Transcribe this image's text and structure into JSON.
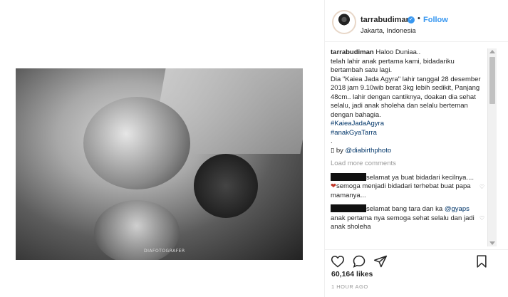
{
  "post": {
    "username": "tarrabudiman",
    "follow_label": "Follow",
    "dot": "•",
    "location": "Jakarta, Indonesia",
    "photo_watermark": "DIAFOTOGRAFER"
  },
  "caption": {
    "user": "tarrabudiman",
    "lines": [
      "Haloo Duniaa..",
      "telah lahir anak pertama kami, bidadariku bertambah satu lagi.",
      "Dia \"Kaiea Jada Agyra\" lahir tanggal 28 desember 2018 jam 9.10wib berat 3kg lebih sedikit, Panjang 48cm.. lahir dengan cantiknya, doakan dia sehat selalu, jadi anak sholeha dan selalu berteman dengan bahagia."
    ],
    "hashtag1": "#KaieaJadaAgyra",
    "hashtag2": "#anakGyaTarra",
    "dot_line": ".",
    "credit_prefix": "▯ by ",
    "credit_mention": "@diabirthphoto"
  },
  "comments": {
    "load_more": "Load more comments",
    "items": [
      {
        "text1": "selamat ya buat bidadari kecilnya....",
        "heart": "❤",
        "text2": "semoga menjadi bidadari terhebat buat papa mamanya..."
      },
      {
        "text1": "selamat bang tara dan ka ",
        "mention": "@gyaps",
        "text2": " anak pertama nya semoga sehat selalu dan jadi anak sholeha"
      }
    ],
    "like_heart": "♡"
  },
  "stats": {
    "likes": "60,164 likes",
    "time": "1 HOUR AGO"
  },
  "icons": [
    "heart-icon",
    "comment-icon",
    "share-icon",
    "bookmark-icon",
    "verified-badge-icon"
  ],
  "colors": {
    "link": "#3897f0",
    "text": "#262626",
    "muted": "#999999",
    "hashtag": "#003569"
  }
}
